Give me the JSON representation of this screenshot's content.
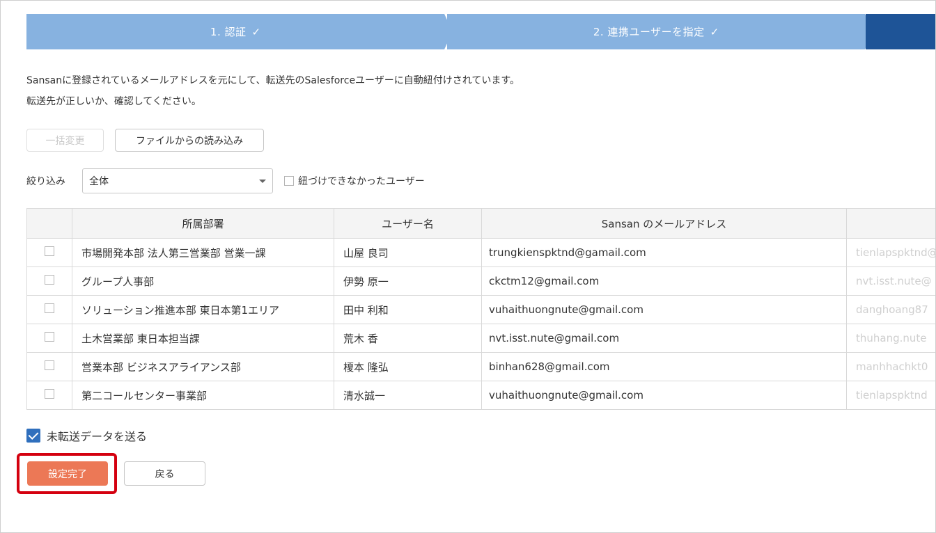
{
  "stepper": {
    "steps": [
      {
        "label": "1. 認証",
        "done": true
      },
      {
        "label": "2. 連携ユーザーを指定",
        "done": true
      },
      {
        "label": "",
        "done": false
      }
    ],
    "check_glyph": "✓",
    "colors": {
      "done": "#87b2e0",
      "current": "#1e5497"
    }
  },
  "description": {
    "line1": "Sansanに登録されているメールアドレスを元にして、転送先のSalesforceユーザーに自動紐付けされています。",
    "line2": "転送先が正しいか、確認してください。"
  },
  "actions": {
    "bulk_change_label": "一括変更",
    "load_file_label": "ファイルからの読み込み"
  },
  "filter": {
    "label": "絞り込み",
    "selected": "全体",
    "unlinked_label": "紐づけできなかったユーザー"
  },
  "table": {
    "headers": [
      "",
      "所属部署",
      "ユーザー名",
      "Sansan のメールアドレス",
      ""
    ],
    "rows": [
      {
        "dept": "市場開発本部 法人第三営業部 営業一課",
        "user": "山屋 良司",
        "email": "trungkienspktnd@gamail.com",
        "sf_email": "tienlapspktnd@"
      },
      {
        "dept": "グループ人事部",
        "user": "伊勢 原一",
        "email": "ckctm12@gmail.com",
        "sf_email": "nvt.isst.nute@"
      },
      {
        "dept": "ソリューション推進本部 東日本第1エリア",
        "user": "田中 利和",
        "email": "vuhaithuongnute@gmail.com",
        "sf_email": "danghoang87"
      },
      {
        "dept": "土木営業部 東日本担当課",
        "user": "荒木 香",
        "email": "nvt.isst.nute@gmail.com",
        "sf_email": "thuhang.nute"
      },
      {
        "dept": "営業本部 ビジネスアライアンス部",
        "user": "榎本 隆弘",
        "email": "binhan628@gmail.com",
        "sf_email": "manhhachkt0"
      },
      {
        "dept": "第二コールセンター事業部",
        "user": "清水誠一",
        "email": "vuhaithuongnute@gmail.com",
        "sf_email": "tienlapspktnd"
      }
    ]
  },
  "send_unsent": {
    "label": "未転送データを送る",
    "checked": true
  },
  "footer": {
    "done_label": "設定完了",
    "back_label": "戻る",
    "done_color": "#ec7856",
    "highlight_color": "#d4000f"
  }
}
